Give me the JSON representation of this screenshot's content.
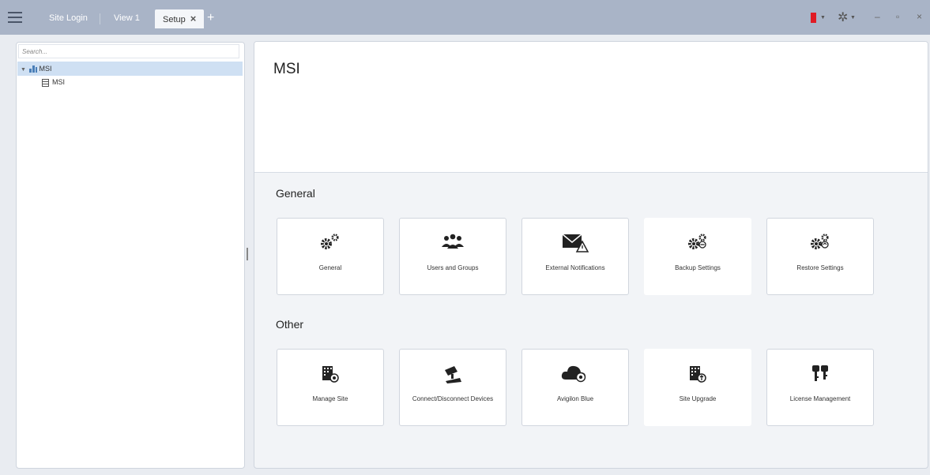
{
  "tabs": [
    {
      "label": "Site Login"
    },
    {
      "label": "View 1"
    },
    {
      "label": "Setup"
    }
  ],
  "tab_close": "×",
  "tab_add": "+",
  "window_controls": {
    "minimize": "–",
    "restore": "▫",
    "close": "×"
  },
  "colors": {
    "titlebar": "#a9b4c7",
    "alarm": "#e01b24",
    "selection": "#cfe0f3"
  },
  "sidebar": {
    "search_placeholder": "Search...",
    "tree": [
      {
        "label": "MSI",
        "expanded": true,
        "icon": "site-icon"
      },
      {
        "label": "MSI",
        "icon": "server-icon"
      }
    ]
  },
  "main": {
    "title": "MSI",
    "sections": [
      {
        "title": "General",
        "items": [
          {
            "label": "General",
            "icon": "gears-icon"
          },
          {
            "label": "Users and Groups",
            "icon": "users-icon"
          },
          {
            "label": "External Notifications",
            "icon": "mail-warning-icon"
          },
          {
            "label": "Backup Settings",
            "icon": "gears-backup-icon"
          },
          {
            "label": "Restore Settings",
            "icon": "gears-restore-icon"
          }
        ]
      },
      {
        "title": "Other",
        "items": [
          {
            "label": "Manage Site",
            "icon": "building-gear-icon"
          },
          {
            "label": "Connect/Disconnect Devices",
            "icon": "camera-icon"
          },
          {
            "label": "Avigilon Blue",
            "icon": "cloud-icon"
          },
          {
            "label": "Site Upgrade",
            "icon": "building-upgrade-icon"
          },
          {
            "label": "License Management",
            "icon": "keys-icon"
          }
        ]
      }
    ]
  }
}
